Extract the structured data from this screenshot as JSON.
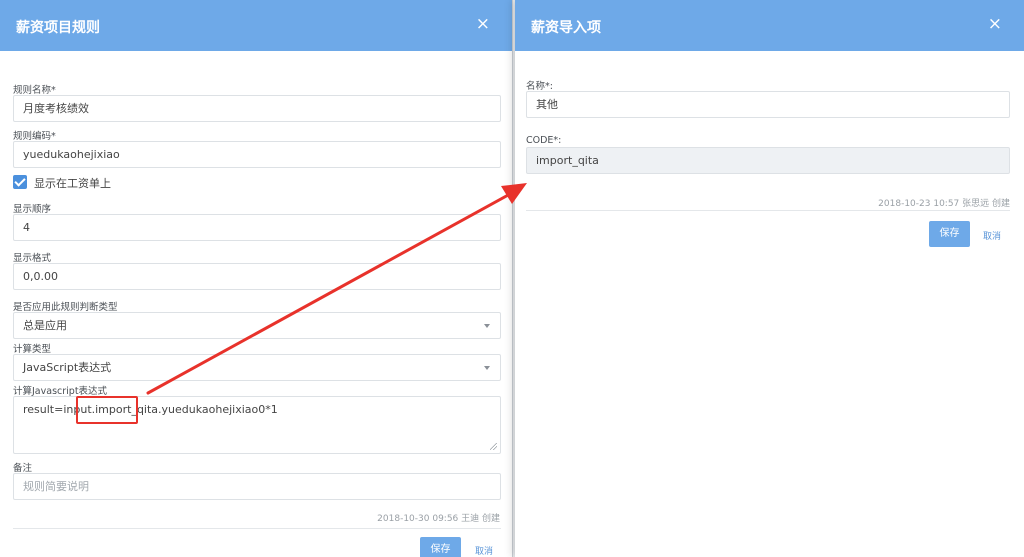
{
  "left_dialog": {
    "title": "薪资项目规则",
    "close_glyph": "×",
    "rule_name_label": "规则名称*",
    "rule_name_value": "月度考核绩效",
    "rule_code_label": "规则编码*",
    "rule_code_value": "yuedukaohejixiao",
    "show_on_payslip_label": "显示在工资单上",
    "show_on_payslip_checked": true,
    "display_order_label": "显示顺序",
    "display_order_value": "4",
    "display_format_label": "显示格式",
    "display_format_value": "0,0.00",
    "apply_rule_type_label": "是否应用此规则判断类型",
    "apply_rule_type_value": "总是应用",
    "calc_type_label": "计算类型",
    "calc_type_value": "JavaScript表达式",
    "js_expr_label": "计算Javascript表达式",
    "js_expr_value": "result=input.import_qita.yuedukaohejixiao0*1",
    "remark_label": "备注",
    "remark_placeholder": "规则简要说明",
    "created_meta": "2018-10-30 09:56 王迪 创建",
    "save_label": "保存",
    "cancel_label": "取消"
  },
  "right_dialog": {
    "title": "薪资导入项",
    "close_glyph": "×",
    "name_label": "名称*:",
    "name_value": "其他",
    "code_label": "CODE*:",
    "code_value": "import_qita",
    "created_meta": "2018-10-23 10:57 张思远 创建",
    "save_label": "保存",
    "cancel_label": "取消"
  },
  "colors": {
    "header_bg": "#6ea9e8",
    "primary_button": "#6ea9e8",
    "annotation_red": "#e8322b",
    "checkbox": "#4b90dd"
  },
  "annotation": {
    "highlighted_text": "import_qita",
    "meaning": "arrow from highlighted expression part to CODE field"
  }
}
